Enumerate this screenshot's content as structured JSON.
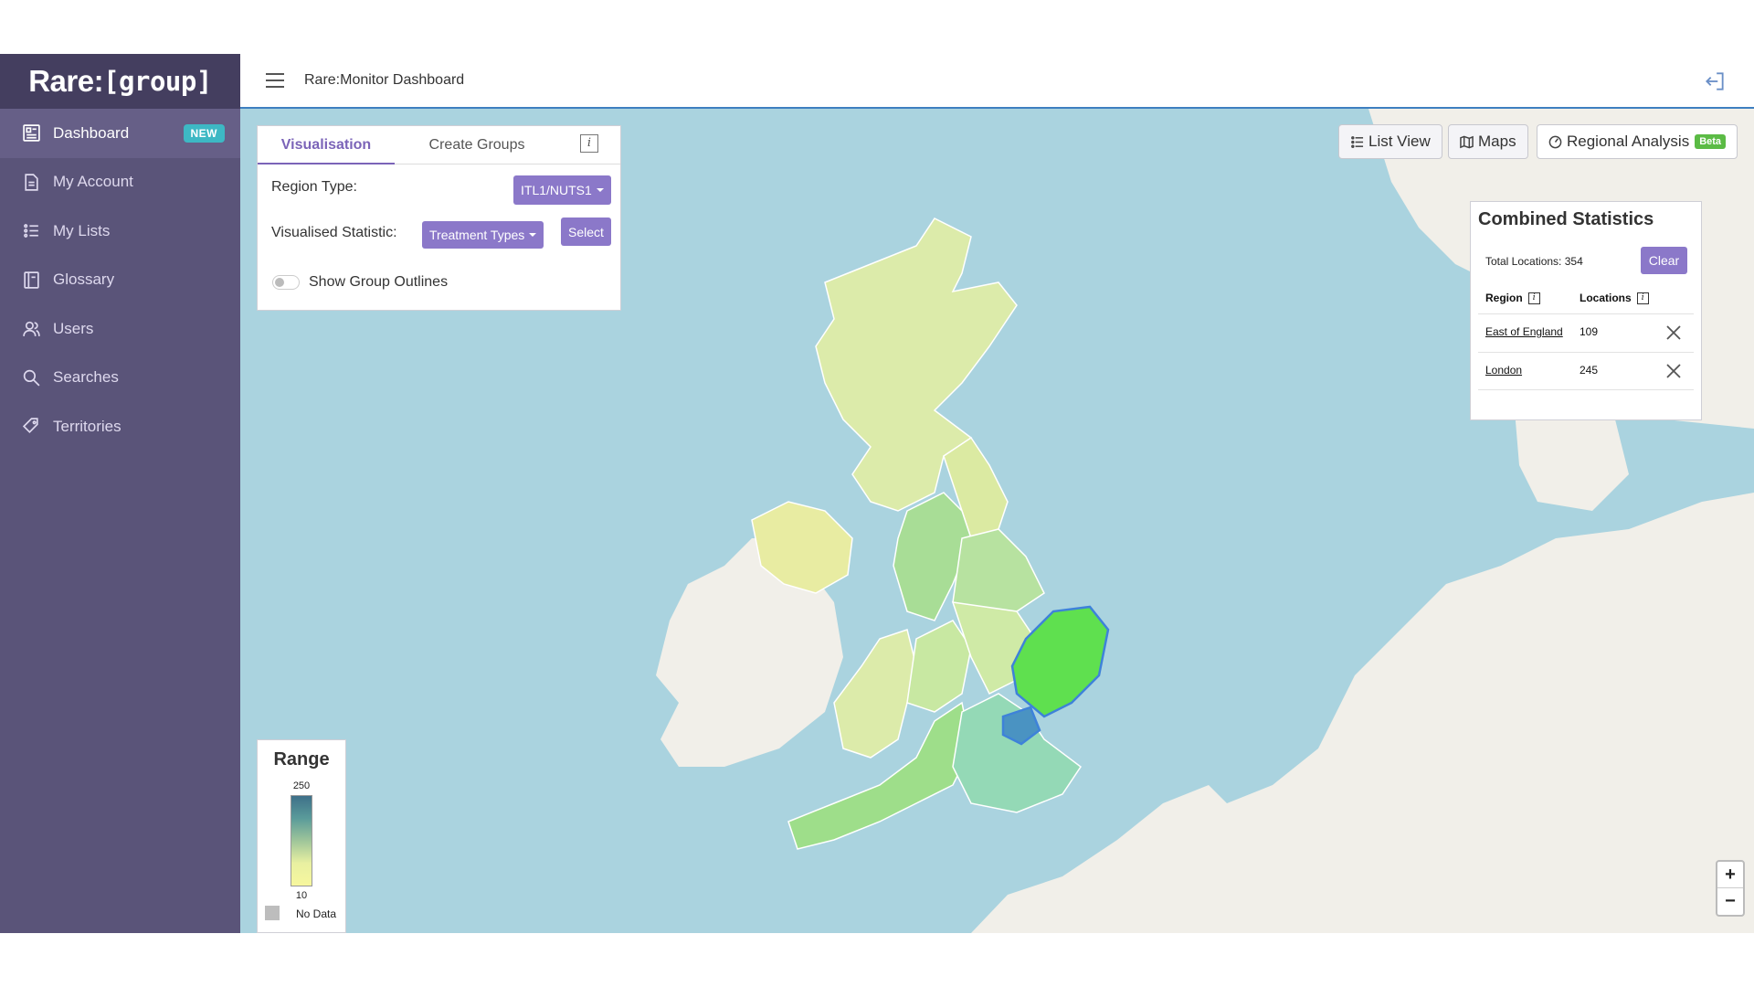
{
  "app": {
    "brand_main": "Rare:",
    "brand_sub": "[group]",
    "title": "Rare:Monitor Dashboard"
  },
  "sidebar": {
    "items": [
      {
        "label": "Dashboard",
        "icon": "dashboard-icon",
        "badge": "NEW",
        "active": true
      },
      {
        "label": "My Account",
        "icon": "document-icon"
      },
      {
        "label": "My Lists",
        "icon": "list-icon"
      },
      {
        "label": "Glossary",
        "icon": "book-icon"
      },
      {
        "label": "Users",
        "icon": "users-icon"
      },
      {
        "label": "Searches",
        "icon": "search-icon"
      },
      {
        "label": "Territories",
        "icon": "tag-icon"
      }
    ]
  },
  "visualisation": {
    "tab_visualisation": "Visualisation",
    "tab_create_groups": "Create Groups",
    "info": "i",
    "region_type_label": "Region Type:",
    "region_type_value": "ITL1/NUTS1",
    "statistic_label": "Visualised Statistic:",
    "statistic_value": "Treatment Types",
    "select_label": "Select",
    "outlines_label": "Show Group Outlines",
    "outlines_on": false
  },
  "views": {
    "list_view": "List View",
    "maps": "Maps",
    "regional_analysis": "Regional Analysis",
    "beta": "Beta"
  },
  "stats": {
    "title": "Combined Statistics",
    "total_label": "Total Locations: 354",
    "clear_label": "Clear",
    "col_region": "Region",
    "col_locations": "Locations",
    "rows": [
      {
        "region": "East of England",
        "locations": "109"
      },
      {
        "region": "London",
        "locations": "245"
      }
    ]
  },
  "range": {
    "title": "Range",
    "max": "250",
    "min": "10",
    "no_data": "No Data"
  },
  "zoom": {
    "in": "+",
    "out": "−"
  },
  "colors": {
    "sidebar": "#5a5479",
    "accent": "#8b78c9",
    "selected_region": "#5fe04f",
    "sea": "#aad3df"
  }
}
